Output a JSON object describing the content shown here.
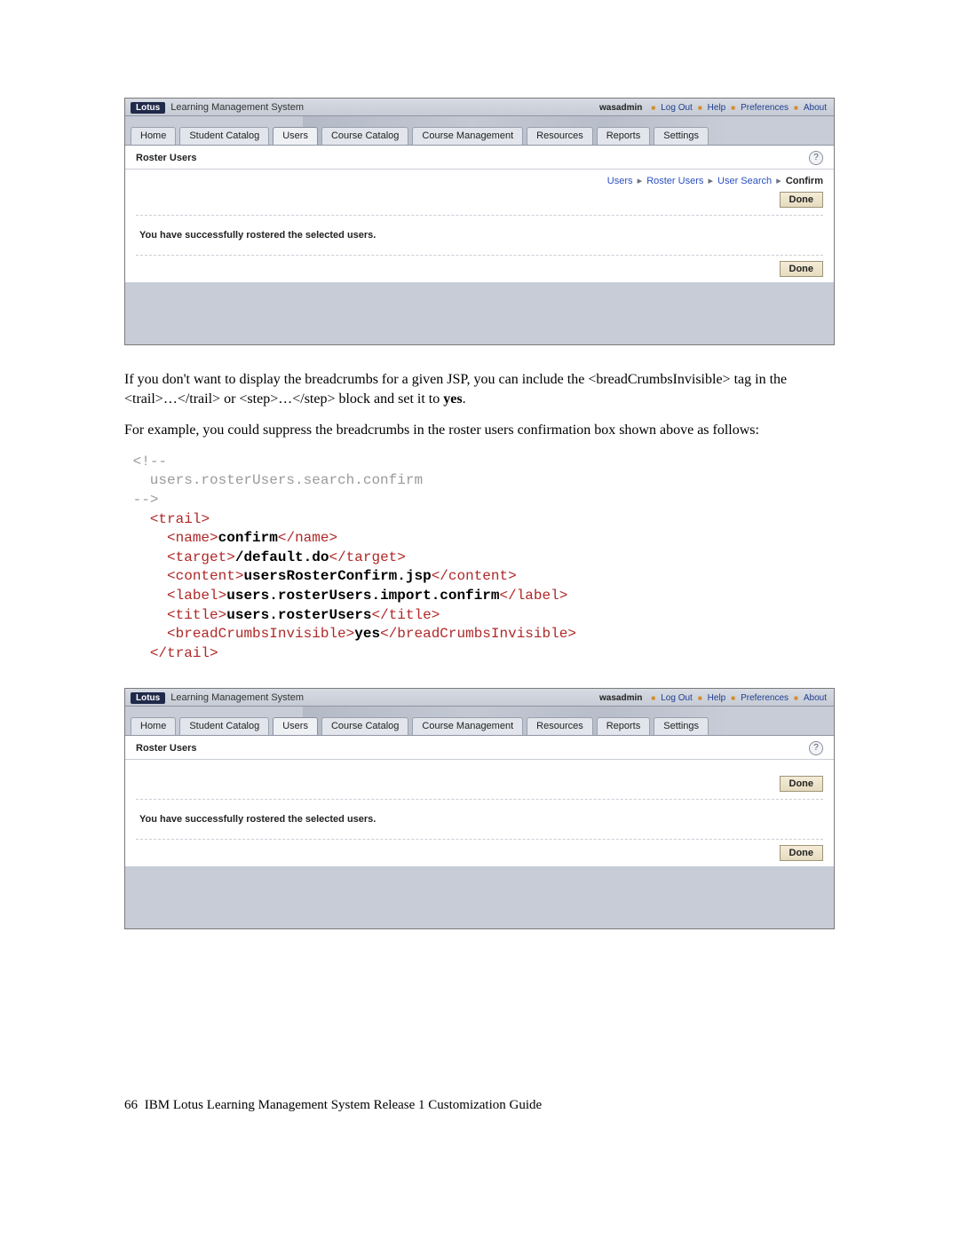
{
  "app": {
    "brand_badge": "Lotus",
    "brand_text": "Learning Management System",
    "user": "wasadmin",
    "header_links": [
      "Log Out",
      "Help",
      "Preferences",
      "About"
    ],
    "tabs": [
      "Home",
      "Student Catalog",
      "Users",
      "Course Catalog",
      "Course Management",
      "Resources",
      "Reports",
      "Settings"
    ],
    "active_tab": "Users",
    "page_title": "Roster Users",
    "breadcrumb": {
      "links": [
        "Users",
        "Roster Users",
        "User Search"
      ],
      "current": "Confirm"
    },
    "done_label": "Done",
    "success_msg": "You have successfully rostered the selected users."
  },
  "doc": {
    "para1_a": "If you don't want to display the breadcrumbs for a given JSP, you can include the <breadCrumbsInvisible> tag in the <trail>…</trail> or <step>…</step> block and set it to ",
    "para1_b": "yes",
    "para1_c": ".",
    "para2": "For example, you could suppress the breadcrumbs in the roster users confirmation box shown above as follows:",
    "code": {
      "comment_open": "<!--",
      "comment_body": "   users.rosterUsers.search.confirm",
      "comment_close": "-->",
      "trail_open": "trail",
      "name_tag": "name",
      "name_val": "confirm",
      "target_tag": "target",
      "target_val": "/default.do",
      "content_tag": "content",
      "content_val": "usersRosterConfirm.jsp",
      "label_tag": "label",
      "label_val": "users.rosterUsers.import.confirm",
      "title_tag": "title",
      "title_val": "users.rosterUsers",
      "bci_tag": "breadCrumbsInvisible",
      "bci_val": "yes",
      "trail_close": "trail"
    }
  },
  "footer": {
    "page_number": "66",
    "title": "IBM Lotus Learning Management System Release 1 Customization Guide"
  }
}
